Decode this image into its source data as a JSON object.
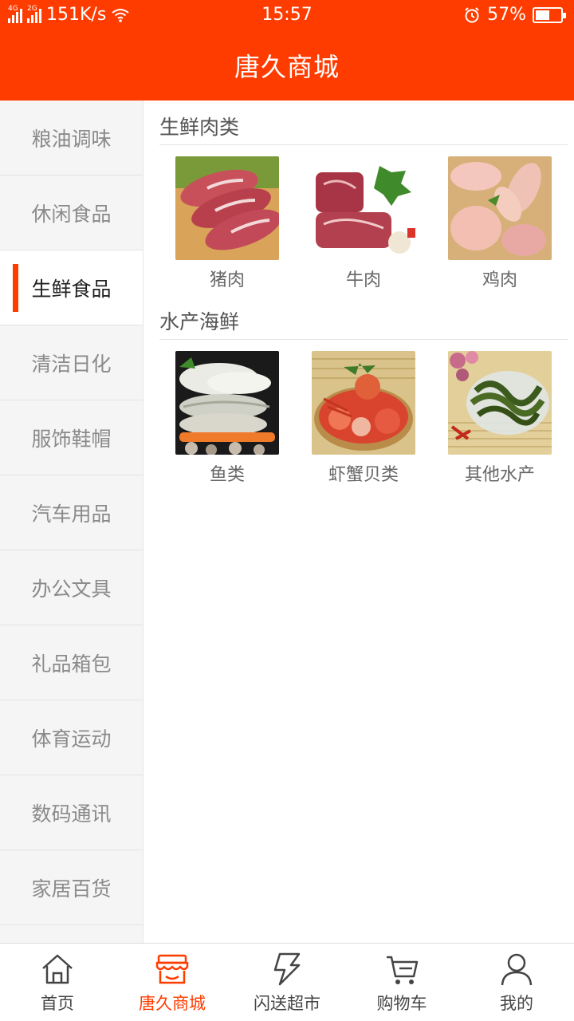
{
  "status_bar": {
    "network_1": "4G",
    "network_2": "2G",
    "speed": "151K/s",
    "time": "15:57",
    "battery": "57%",
    "battery_level": 0.57
  },
  "header": {
    "title": "唐久商城"
  },
  "sidebar": {
    "items": [
      {
        "label": "粮油调味"
      },
      {
        "label": "休闲食品"
      },
      {
        "label": "生鲜食品"
      },
      {
        "label": "清洁日化"
      },
      {
        "label": "服饰鞋帽"
      },
      {
        "label": "汽车用品"
      },
      {
        "label": "办公文具"
      },
      {
        "label": "礼品箱包"
      },
      {
        "label": "体育运动"
      },
      {
        "label": "数码通讯"
      },
      {
        "label": "家居百货"
      }
    ],
    "active_index": 2
  },
  "sections": [
    {
      "title": "生鲜肉类",
      "items": [
        {
          "label": "猪肉",
          "image": "pork-image"
        },
        {
          "label": "牛肉",
          "image": "beef-image"
        },
        {
          "label": "鸡肉",
          "image": "chicken-image"
        }
      ]
    },
    {
      "title": "水产海鲜",
      "items": [
        {
          "label": "鱼类",
          "image": "fish-image"
        },
        {
          "label": "虾蟹贝类",
          "image": "shellfish-image"
        },
        {
          "label": "其他水产",
          "image": "seaweed-image"
        }
      ]
    }
  ],
  "bottom_nav": {
    "tabs": [
      {
        "label": "首页",
        "icon": "home-icon"
      },
      {
        "label": "唐久商城",
        "icon": "store-icon"
      },
      {
        "label": "闪送超市",
        "icon": "lightning-icon"
      },
      {
        "label": "购物车",
        "icon": "cart-icon"
      },
      {
        "label": "我的",
        "icon": "user-icon"
      }
    ],
    "active_index": 1
  },
  "colors": {
    "accent": "#ff3c00",
    "sidebar_bg": "#f5f5f5"
  }
}
